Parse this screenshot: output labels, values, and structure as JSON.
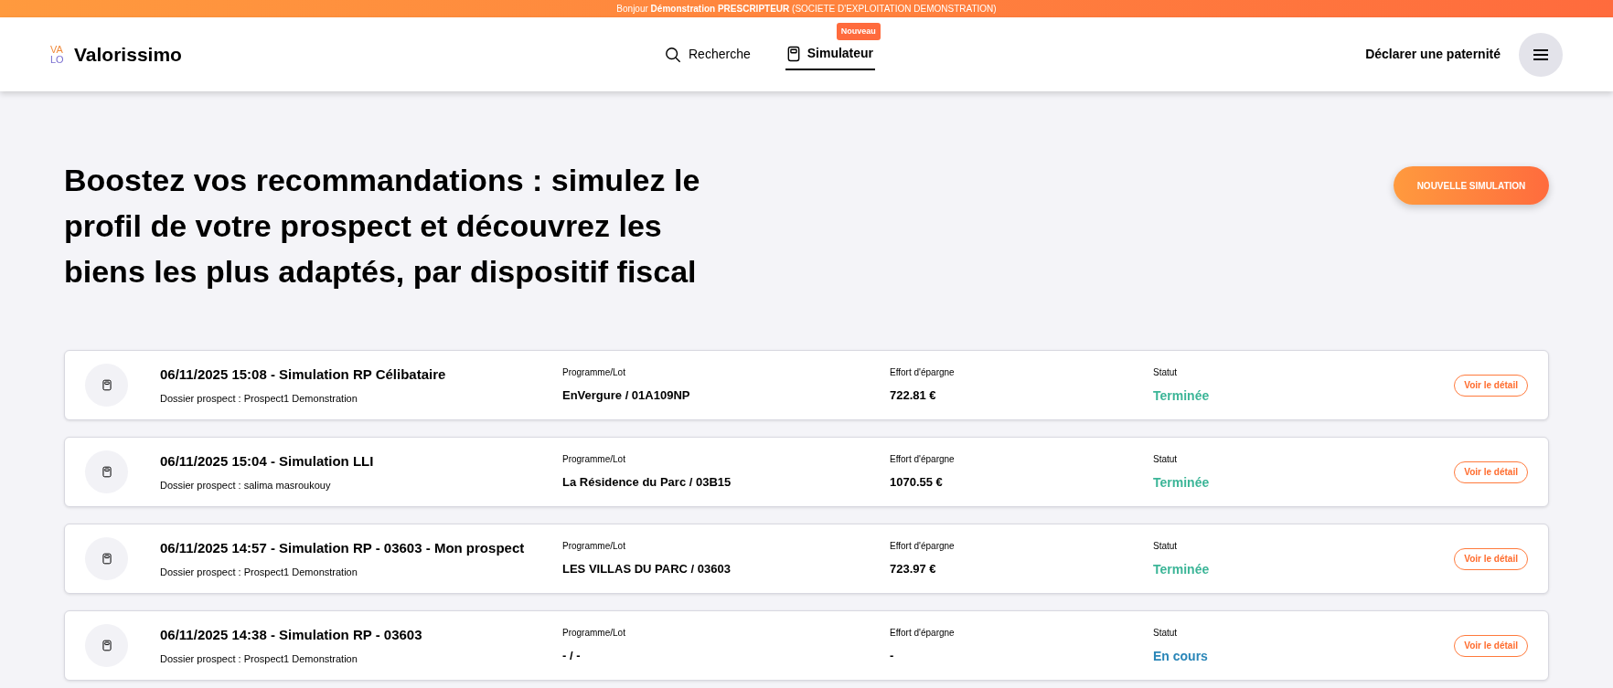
{
  "top_banner": {
    "greeting": "Bonjour **Démonstration PRESCRIPTEUR** (SOCIETE D'EXPLOITATION DEMONSTRATION)"
  },
  "header": {
    "logo_mark": [
      "VA",
      "LO"
    ],
    "brand": "Valorissimo",
    "nav": [
      {
        "kind": "search",
        "label": "Recherche",
        "selected": false
      },
      {
        "kind": "simulator",
        "label": "Simulateur",
        "selected": true,
        "badge": "Nouveau"
      }
    ],
    "declare_link": "Déclarer une paternité"
  },
  "hero": {
    "title": "Boostez vos recommandations : simulez le profil de votre prospect et découvrez les biens les plus adaptés, par dispositif fiscal",
    "button": "NOUVELLE SIMULATION"
  },
  "simulations": [
    {
      "title": "06/11/2025 15:08 - Simulation RP Célibataire",
      "prospect": "Dossier prospect : Prospect1 Demonstration",
      "program_label": "Programme/Lot",
      "program": "EnVergure / 01A109NP",
      "effort_label": "Effort d'épargne",
      "effort": "722.81 €",
      "status_label": "Statut",
      "status": "Terminée",
      "done": true,
      "button": "Voir le détail"
    },
    {
      "title": "06/11/2025 15:04 - Simulation LLI",
      "prospect": "Dossier prospect : salima masroukouy",
      "program_label": "Programme/Lot",
      "program": "La Résidence du Parc / 03B15",
      "effort_label": "Effort d'épargne",
      "effort": "1070.55 €",
      "status_label": "Statut",
      "status": "Terminée",
      "done": true,
      "button": "Voir le détail"
    },
    {
      "title": "06/11/2025 14:57 - Simulation RP - 03603 - Mon prospect",
      "prospect": "Dossier prospect : Prospect1 Demonstration",
      "program_label": "Programme/Lot",
      "program": "LES VILLAS DU PARC / 03603",
      "effort_label": "Effort d'épargne",
      "effort": "723.97 €",
      "status_label": "Statut",
      "status": "Terminée",
      "done": true,
      "button": "Voir le détail"
    },
    {
      "title": "06/11/2025 14:38 - Simulation RP - 03603",
      "prospect": "Dossier prospect : Prospect1 Demonstration",
      "program_label": "Programme/Lot",
      "program": "- / -",
      "effort_label": "Effort d'épargne",
      "effort": "-",
      "status_label": "Statut",
      "status": "En cours",
      "done": false,
      "button": "Voir le détail"
    }
  ]
}
